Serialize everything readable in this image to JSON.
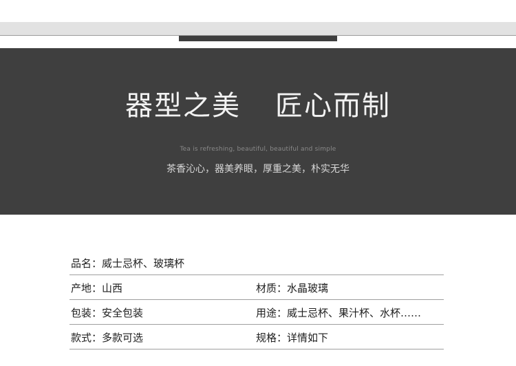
{
  "banner": {
    "title_left": "器型之美",
    "title_right": "匠心而制",
    "subtitle_en": "Tea is refreshing, beautiful, beautiful and simple",
    "subtitle_cn": "茶香沁心，器美养眼，厚重之美，朴实无华"
  },
  "specs": [
    {
      "left": "品名：威士忌杯、玻璃杯",
      "right": ""
    },
    {
      "left": "产地：山西",
      "right": "材质：水晶玻璃"
    },
    {
      "left": "包装：安全包装",
      "right": "用途：威士忌杯、果汁杯、水杯……"
    },
    {
      "left": "款式：多款可选",
      "right": "规格：详情如下"
    }
  ]
}
